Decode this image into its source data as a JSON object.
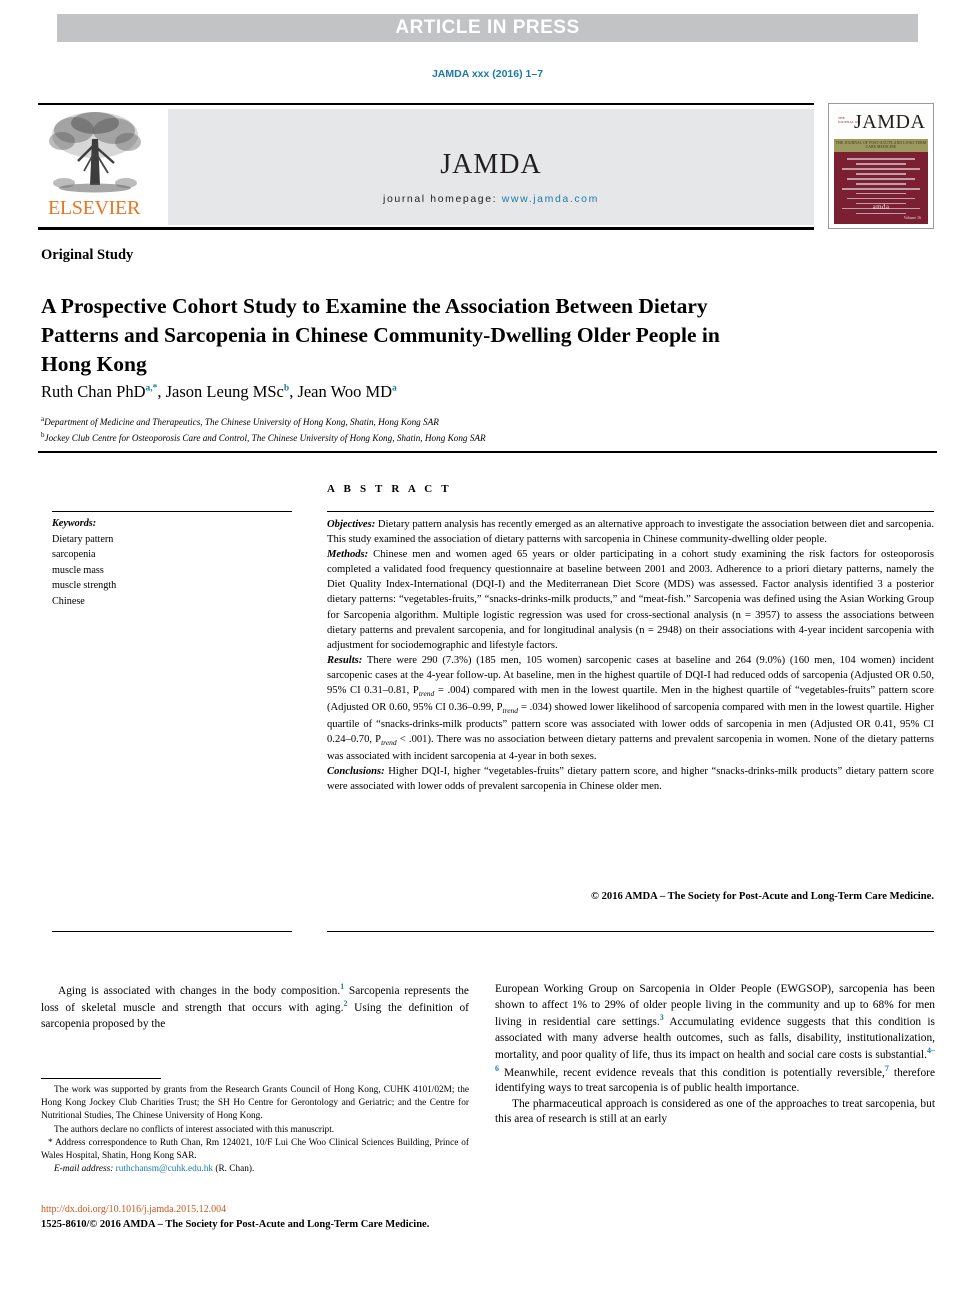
{
  "banner": {
    "text": "ARTICLE IN PRESS"
  },
  "citation": {
    "text": "JAMDA xxx (2016) 1–7"
  },
  "masthead": {
    "publisher": "ELSEVIER",
    "journal_title": "JAMDA",
    "homepage_label": "journal homepage:",
    "homepage_url": "www.jamda.com",
    "cover": {
      "title": "JAMDA",
      "kicker": "THE JOURNAL OF\nPOST-ACUTE AND\nLONG-TERM CARE\nMEDICINE",
      "subtitle": "THE JOURNAL OF POST-ACUTE AND LONG-TERM CARE MEDICINE",
      "society_logo": "amda",
      "society_tagline": "THE SOCIETY FOR POST-ACUTE AND LONG-TERM CARE MEDICINE",
      "volume_note": "Volume 16"
    }
  },
  "article": {
    "section_label": "Original Study",
    "title": "A Prospective Cohort Study to Examine the Association Between Dietary Patterns and Sarcopenia in Chinese Community-Dwelling Older People in Hong Kong",
    "authors": [
      {
        "name": "Ruth Chan PhD",
        "marks": "a,*"
      },
      {
        "name": "Jason Leung MSc",
        "marks": "b"
      },
      {
        "name": "Jean Woo MD",
        "marks": "a"
      }
    ],
    "affiliations": [
      {
        "mark": "a",
        "text": "Department of Medicine and Therapeutics, The Chinese University of Hong Kong, Shatin, Hong Kong SAR"
      },
      {
        "mark": "b",
        "text": "Jockey Club Centre for Osteoporosis Care and Control, The Chinese University of Hong Kong, Shatin, Hong Kong SAR"
      }
    ]
  },
  "keywords": {
    "heading": "Keywords:",
    "items": [
      "Dietary pattern",
      "sarcopenia",
      "muscle mass",
      "muscle strength",
      "Chinese"
    ]
  },
  "abstract": {
    "label": "A B S T R A C T",
    "objectives_label": "Objectives:",
    "objectives": " Dietary pattern analysis has recently emerged as an alternative approach to investigate the association between diet and sarcopenia. This study examined the association of dietary patterns with sarcopenia in Chinese community-dwelling older people.",
    "methods_label": "Methods:",
    "methods": " Chinese men and women aged 65 years or older participating in a cohort study examining the risk factors for osteoporosis completed a validated food frequency questionnaire at baseline between 2001 and 2003. Adherence to a priori dietary patterns, namely the Diet Quality Index-International (DQI-I) and the Mediterranean Diet Score (MDS) was assessed. Factor analysis identified 3 a posterior dietary patterns: “vegetables-fruits,” “snacks-drinks-milk products,” and “meat-fish.” Sarcopenia was defined using the Asian Working Group for Sarcopenia algorithm. Multiple logistic regression was used for cross-sectional analysis (n = 3957) to assess the associations between dietary patterns and prevalent sarcopenia, and for longitudinal analysis (n = 2948) on their associations with 4-year incident sarcopenia with adjustment for sociodemographic and lifestyle factors.",
    "results_label": "Results:",
    "results_part1": " There were 290 (7.3%) (185 men, 105 women) sarcopenic cases at baseline and 264 (9.0%) (160 men, 104 women) incident sarcopenic cases at the 4-year follow-up. At baseline, men in the highest quartile of DQI-I had reduced odds of sarcopenia (Adjusted OR 0.50, 95% CI 0.31–0.81, P",
    "results_sub1": "trend",
    "results_part2": " = .004) compared with men in the lowest quartile. Men in the highest quartile of “vegetables-fruits” pattern score (Adjusted OR 0.60, 95% CI 0.36–0.99, P",
    "results_sub2": "trend",
    "results_part3": " = .034) showed lower likelihood of sarcopenia compared with men in the lowest quartile. Higher quartile of “snacks-drinks-milk products” pattern score was associated with lower odds of sarcopenia in men (Adjusted OR 0.41, 95% CI 0.24–0.70, P",
    "results_sub3": "trend",
    "results_part4": " < .001). There was no association between dietary patterns and prevalent sarcopenia in women. None of the dietary patterns was associated with incident sarcopenia at 4-year in both sexes.",
    "conclusions_label": "Conclusions:",
    "conclusions": " Higher DQI-I, higher “vegetables-fruits” dietary pattern score, and higher “snacks-drinks-milk products” dietary pattern score were associated with lower odds of prevalent sarcopenia in Chinese older men.",
    "copyright": "© 2016 AMDA – The Society for Post-Acute and Long-Term Care Medicine."
  },
  "body": {
    "left_para1_a": "Aging is associated with changes in the body composition.",
    "left_ref1": "1",
    "left_para1_b": " Sarcopenia represents the loss of skeletal muscle and strength that occurs with aging.",
    "left_ref2": "2",
    "left_para1_c": " Using the definition of sarcopenia proposed by the",
    "right_para1_a": "European Working Group on Sarcopenia in Older People (EWGSOP), sarcopenia has been shown to affect 1% to 29% of older people living in the community and up to 68% for men living in residential care settings.",
    "right_ref3": "3",
    "right_para1_b": " Accumulating evidence suggests that this condition is associated with many adverse health outcomes, such as falls, disability, institutionalization, mortality, and poor quality of life, thus its impact on health and social care costs is substantial.",
    "right_ref46": "4–6",
    "right_para1_c": " Meanwhile, recent evidence reveals that this condition is potentially reversible,",
    "right_ref7": "7",
    "right_para1_d": " therefore identifying ways to treat sarcopenia is of public health importance.",
    "right_para2": "The pharmaceutical approach is considered as one of the approaches to treat sarcopenia, but this area of research is still at an early"
  },
  "footnotes": {
    "funding": "The work was supported by grants from the Research Grants Council of Hong Kong, CUHK 4101/02M; the Hong Kong Jockey Club Charities Trust; the SH Ho Centre for Gerontology and Geriatric; and the Centre for Nutritional Studies, The Chinese University of Hong Kong.",
    "conflicts": "The authors declare no conflicts of interest associated with this manuscript.",
    "correspondence_mark": "*",
    "correspondence": " Address correspondence to Ruth Chan, Rm 124021, 10/F Lui Che Woo Clinical Sciences Building, Prince of Wales Hospital, Shatin, Hong Kong SAR.",
    "email_label": "E-mail address:",
    "email": "ruthchansm@cuhk.edu.hk",
    "email_owner": " (R. Chan)."
  },
  "footer": {
    "doi": "http://dx.doi.org/10.1016/j.jamda.2015.12.004",
    "issn": "1525-8610/© 2016 AMDA – The Society for Post-Acute and Long-Term Care Medicine."
  },
  "colors": {
    "link_blue": "#1b7ba8",
    "elsevier_orange": "#e87722",
    "banner_gray": "#c2c3c5",
    "band_gray": "#e6e7e8",
    "cover_maroon": "#7b1f33",
    "doi_orange": "#c8561e"
  }
}
